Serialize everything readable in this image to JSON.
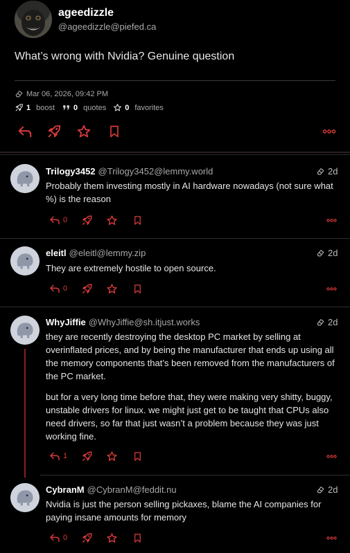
{
  "post": {
    "author_name": "ageedizzle",
    "author_handle": "@ageedizzle@piefed.ca",
    "text": "What’s wrong with Nvidia? Genuine question",
    "timestamp": "Mar 06, 2026, 09:42 PM",
    "boosts_count": "1",
    "boosts_label": "boost",
    "quotes_count": "0",
    "quotes_label": "quotes",
    "favorites_count": "0",
    "favorites_label": "favorites"
  },
  "replies": [
    {
      "name": "Trilogy3452",
      "handle": "@Trilogy3452@lemmy.world",
      "time": "2d",
      "paragraphs": [
        "Probably them investing mostly in AI hardware nowadays (not sure what %) is the reason"
      ],
      "reply_count": "0"
    },
    {
      "name": "eleitl",
      "handle": "@eleitl@lemmy.zip",
      "time": "2d",
      "paragraphs": [
        "They are extremely hostile to open source."
      ],
      "reply_count": "0"
    },
    {
      "name": "WhyJiffie",
      "handle": "@WhyJiffie@sh.itjust.works",
      "time": "2d",
      "paragraphs": [
        "they are recently destroying the desktop PC market by selling at overinflated prices, and by being the manufacturer that ends up using all the memory components that’s been removed from the manufacturers of the PC market.",
        "but for a very long time before that, they were making very shitty, buggy, unstable drivers for linux. we might just get to be taught that CPUs also need drivers, so far that just wasn’t a problem because they was just working fine."
      ],
      "reply_count": "1"
    },
    {
      "name": "CybranM",
      "handle": "@CybranM@feddit.nu",
      "time": "2d",
      "paragraphs": [
        "Nvidia is just the person selling pickaxes, blame the AI companies for paying insane amounts for memory"
      ],
      "reply_count": "0"
    }
  ],
  "icons": {
    "reply": "reply-icon",
    "boost": "rocket-icon",
    "favorite": "star-icon",
    "bookmark": "bookmark-icon",
    "more": "more-icon",
    "edited": "eraser-icon",
    "quote": "quote-icon",
    "default_avatar": "mastodon-elephant-icon"
  },
  "colors": {
    "accent": "#d93a3a",
    "background": "#000000",
    "thread_line": "#8a1f1f"
  }
}
